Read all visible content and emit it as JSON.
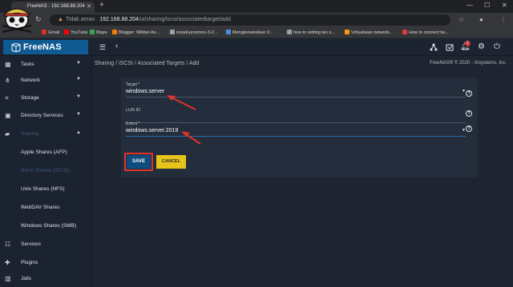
{
  "browser": {
    "tab_title": "FreeNAS - 192.168.88.204",
    "omnibox": {
      "security_label": "Tidak aman",
      "host": "192.168.88.204",
      "path": "/ui/sharing/iscsi/associatedtarget/add"
    },
    "bookmarks": [
      {
        "label": "Gmail",
        "icon": "gmail-icon",
        "color": "#d93025"
      },
      {
        "label": "YouTube",
        "icon": "youtube-icon",
        "color": "#ff0000"
      },
      {
        "label": "Maps",
        "icon": "maps-icon",
        "color": "#34a853"
      },
      {
        "label": "Blogger: Wildan As...",
        "icon": "blogger-icon",
        "color": "#f57d00"
      },
      {
        "label": "install-proxmox-3-2...",
        "icon": "bookmark-icon",
        "color": "#9aa0a6"
      },
      {
        "label": "Mengkoneksikan V...",
        "icon": "bookmark-icon",
        "color": "#4a90d9"
      },
      {
        "label": "how to setting lan s...",
        "icon": "bookmark-icon",
        "color": "#9aa0a6"
      },
      {
        "label": "Virtualisasi network...",
        "icon": "bookmark-icon",
        "color": "#ff9800"
      },
      {
        "label": "How to connect tw...",
        "icon": "bookmark-icon",
        "color": "#e53935"
      }
    ]
  },
  "app": {
    "brand_name": "FreeNAS",
    "notification_count": "1",
    "copyright": "FreeNAS® © 2020 - iXsystems, Inc."
  },
  "sidebar": {
    "items": [
      {
        "label": "Tasks",
        "icon": "calendar-icon"
      },
      {
        "label": "Network",
        "icon": "network-icon"
      },
      {
        "label": "Storage",
        "icon": "storage-icon"
      },
      {
        "label": "Directory Services",
        "icon": "directory-icon"
      },
      {
        "label": "Sharing",
        "icon": "folder-icon"
      }
    ],
    "sub_items": [
      {
        "label": "Apple Shares (AFP)"
      },
      {
        "label": "Block Shares (iSCSI)"
      },
      {
        "label": "Unix Shares (NFS)"
      },
      {
        "label": "WebDAV Shares"
      },
      {
        "label": "Windows Shares (SMB)"
      }
    ],
    "bottom_items": [
      {
        "label": "Services",
        "icon": "sliders-icon"
      },
      {
        "label": "Plugins",
        "icon": "puzzle-icon"
      },
      {
        "label": "Jails",
        "icon": "jail-icon"
      }
    ]
  },
  "breadcrumb": {
    "items": [
      "Sharing",
      "iSCSI",
      "Associated Targets",
      "Add"
    ],
    "separator": "/"
  },
  "form": {
    "target": {
      "label": "Target *",
      "value": "windows.server"
    },
    "lun_id": {
      "label": "LUN ID",
      "value": ""
    },
    "extent": {
      "label": "Extent *",
      "value": "windows.server.2019"
    },
    "help_glyph": "?",
    "save_label": "SAVE",
    "cancel_label": "CANCEL"
  },
  "colors": {
    "brand": "#0f5a93",
    "save": "#0e4d7e",
    "cancel": "#e6c419",
    "annotation": "#e0322e"
  }
}
